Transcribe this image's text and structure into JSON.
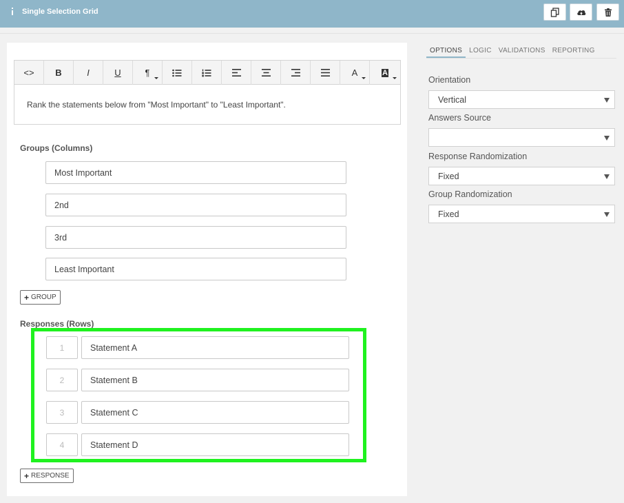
{
  "header": {
    "title": "Single Selection Grid",
    "buttons": [
      {
        "icon": "copy-icon"
      },
      {
        "icon": "cloud-upload-icon"
      },
      {
        "icon": "trash-icon"
      }
    ]
  },
  "editor": {
    "toolbar": [
      {
        "name": "code",
        "label": "<>"
      },
      {
        "name": "bold",
        "label": "B"
      },
      {
        "name": "italic",
        "label": "I"
      },
      {
        "name": "underline",
        "label": "U"
      },
      {
        "name": "paragraph",
        "label": "¶"
      },
      {
        "name": "bullet-list",
        "label": ""
      },
      {
        "name": "numbered-list",
        "label": ""
      },
      {
        "name": "align-left",
        "label": ""
      },
      {
        "name": "align-center",
        "label": ""
      },
      {
        "name": "align-right",
        "label": ""
      },
      {
        "name": "justify",
        "label": ""
      },
      {
        "name": "font-color",
        "label": "A"
      },
      {
        "name": "highlight-color",
        "label": "A"
      }
    ],
    "text": "Rank the statements below from \"Most Important\" to \"Least Important\"."
  },
  "groups": {
    "label": "Groups (Columns)",
    "items": [
      "Most Important",
      "2nd",
      "3rd",
      "Least Important"
    ],
    "add_button": "GROUP"
  },
  "responses": {
    "label": "Responses (Rows)",
    "items": [
      {
        "num": "1",
        "text": "Statement A"
      },
      {
        "num": "2",
        "text": "Statement B"
      },
      {
        "num": "3",
        "text": "Statement C"
      },
      {
        "num": "4",
        "text": "Statement D"
      }
    ],
    "add_button": "RESPONSE",
    "highlight_color": "#1ff21f"
  },
  "sidebar": {
    "tabs": [
      "OPTIONS",
      "LOGIC",
      "VALIDATIONS",
      "REPORTING"
    ],
    "active_tab": "OPTIONS",
    "options": {
      "orientation": {
        "label": "Orientation",
        "value": "Vertical"
      },
      "answers_source": {
        "label": "Answers Source",
        "value": ""
      },
      "response_randomization": {
        "label": "Response Randomization",
        "value": "Fixed"
      },
      "group_randomization": {
        "label": "Group Randomization",
        "value": "Fixed"
      }
    }
  },
  "colors": {
    "header_bg": "#8fb6c9"
  }
}
